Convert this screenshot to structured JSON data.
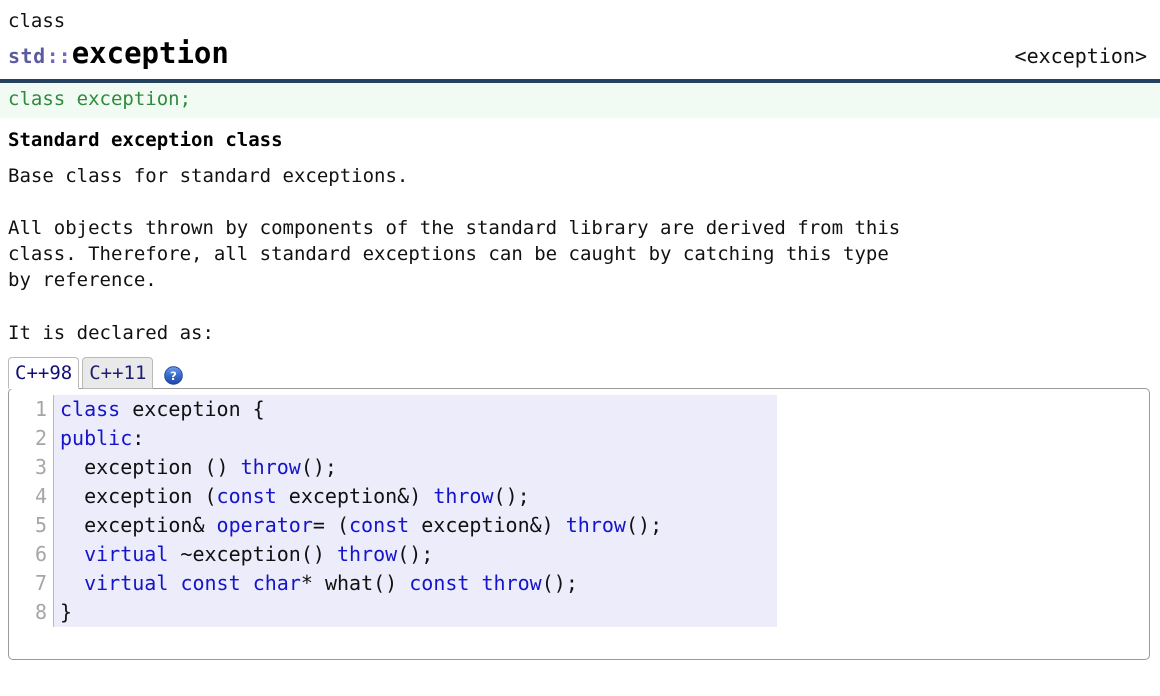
{
  "header": {
    "kind": "class",
    "namespace": "std",
    "separator": "::",
    "name": "exception",
    "include": "<exception>"
  },
  "signature": {
    "text": "class exception;"
  },
  "body": {
    "subtitle": "Standard exception class",
    "lead": "Base class for standard exceptions.",
    "description": "All objects thrown by components of the standard library are derived from this\nclass. Therefore, all standard exceptions can be caught by catching this type\nby reference.",
    "declared_as": "It is declared as:"
  },
  "tabs": {
    "items": [
      {
        "label": "C++98",
        "active": true
      },
      {
        "label": "C++11",
        "active": false
      }
    ],
    "help_icon": "question-help-icon"
  },
  "code": {
    "line_numbers": [
      "1",
      "2",
      "3",
      "4",
      "5",
      "6",
      "7",
      "8"
    ],
    "lines": [
      [
        {
          "t": "class",
          "c": "kw"
        },
        {
          "t": " exception {",
          "c": "pl"
        }
      ],
      [
        {
          "t": "public",
          "c": "kw"
        },
        {
          "t": ":",
          "c": "pl"
        }
      ],
      [
        {
          "t": "  exception () ",
          "c": "pl"
        },
        {
          "t": "throw",
          "c": "kw"
        },
        {
          "t": "();",
          "c": "pl"
        }
      ],
      [
        {
          "t": "  exception (",
          "c": "pl"
        },
        {
          "t": "const",
          "c": "kw"
        },
        {
          "t": " exception&) ",
          "c": "pl"
        },
        {
          "t": "throw",
          "c": "kw"
        },
        {
          "t": "();",
          "c": "pl"
        }
      ],
      [
        {
          "t": "  exception& ",
          "c": "pl"
        },
        {
          "t": "operator",
          "c": "kw"
        },
        {
          "t": "= (",
          "c": "pl"
        },
        {
          "t": "const",
          "c": "kw"
        },
        {
          "t": " exception&) ",
          "c": "pl"
        },
        {
          "t": "throw",
          "c": "kw"
        },
        {
          "t": "();",
          "c": "pl"
        }
      ],
      [
        {
          "t": "  ",
          "c": "pl"
        },
        {
          "t": "virtual",
          "c": "kw"
        },
        {
          "t": " ~exception() ",
          "c": "pl"
        },
        {
          "t": "throw",
          "c": "kw"
        },
        {
          "t": "();",
          "c": "pl"
        }
      ],
      [
        {
          "t": "  ",
          "c": "pl"
        },
        {
          "t": "virtual",
          "c": "kw"
        },
        {
          "t": " ",
          "c": "pl"
        },
        {
          "t": "const",
          "c": "kw"
        },
        {
          "t": " ",
          "c": "pl"
        },
        {
          "t": "char",
          "c": "kw"
        },
        {
          "t": "* what() ",
          "c": "pl"
        },
        {
          "t": "const",
          "c": "kw"
        },
        {
          "t": " ",
          "c": "pl"
        },
        {
          "t": "throw",
          "c": "kw"
        },
        {
          "t": "();",
          "c": "pl"
        }
      ],
      [
        {
          "t": "}",
          "c": "pl"
        }
      ]
    ]
  },
  "colors": {
    "rule": "#26415e",
    "signature_bg": "#f2fbf3",
    "signature_text": "#2e8b3d",
    "namespace": "#5b5ba0",
    "separator": "#7a63c0",
    "code_bg": "#ececfb",
    "keyword": "#1414c8",
    "gutter_text": "#a6a6a6",
    "tab_text": "#1d1d73",
    "tab_inactive_bg": "#e9e9e9",
    "help_icon": "#2f62c8"
  }
}
